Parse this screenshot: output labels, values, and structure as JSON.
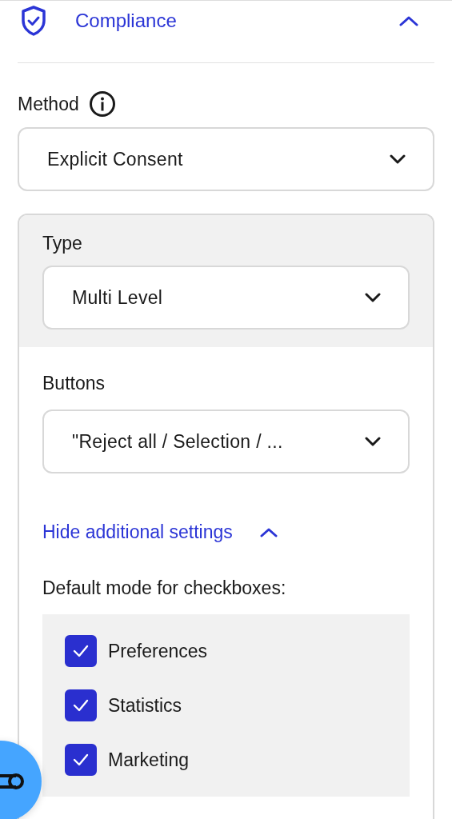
{
  "section": {
    "title": "Compliance",
    "expanded": true
  },
  "method": {
    "label": "Method",
    "value": "Explicit Consent"
  },
  "type": {
    "label": "Type",
    "value": "Multi Level"
  },
  "buttons": {
    "label": "Buttons",
    "value": "\"Reject all / Selection / ..."
  },
  "settings_toggle": {
    "label": "Hide additional settings",
    "expanded": true
  },
  "checkboxes": {
    "label": "Default mode for checkboxes:",
    "items": [
      {
        "label": "Preferences",
        "checked": true
      },
      {
        "label": "Statistics",
        "checked": true
      },
      {
        "label": "Marketing",
        "checked": true
      }
    ]
  }
}
